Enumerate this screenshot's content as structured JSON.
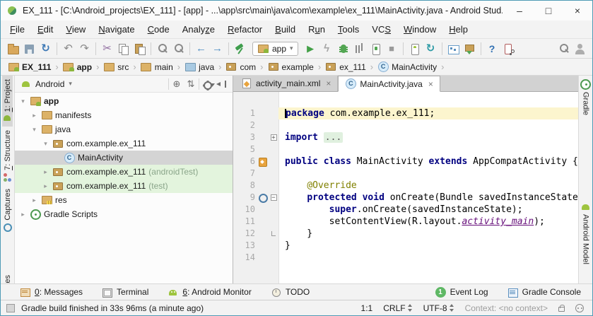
{
  "window": {
    "title": "EX_111 - [C:\\Android_projects\\EX_111] - [app] - ...\\app\\src\\main\\java\\com\\example\\ex_111\\MainActivity.java - Android Stud...",
    "controls": {
      "minimize": "–",
      "maximize": "□",
      "close": "×"
    }
  },
  "colors": {
    "android_green": "#a4c639",
    "keyword_navy": "#000080",
    "annotation_olive": "#808000",
    "resource_purple": "#660e7a",
    "caret_line_yellow": "#fcf5ce",
    "selected_row_gray": "#d4d4d4",
    "test_row_green": "#e3f4dd",
    "event_badge_green": "#5fb865",
    "run_green": "#43a047"
  },
  "menu": [
    {
      "label": "File",
      "m": 0
    },
    {
      "label": "Edit",
      "m": 0
    },
    {
      "label": "View",
      "m": 0
    },
    {
      "label": "Navigate",
      "m": 0
    },
    {
      "label": "Code",
      "m": 0
    },
    {
      "label": "Analyze",
      "m": 5
    },
    {
      "label": "Refactor",
      "m": 0
    },
    {
      "label": "Build",
      "m": 0
    },
    {
      "label": "Run",
      "m": 1
    },
    {
      "label": "Tools",
      "m": 0
    },
    {
      "label": "VCS",
      "m": 2
    },
    {
      "label": "Window",
      "m": 0
    },
    {
      "label": "Help",
      "m": 0
    }
  ],
  "toolbar": {
    "run_config": "app",
    "icons": [
      "open",
      "save",
      "sync",
      "sep",
      "undo",
      "redo",
      "sep",
      "cut",
      "copy",
      "paste",
      "sep",
      "find",
      "replace",
      "sep",
      "back",
      "forward",
      "sep",
      "hammer",
      "runconfig",
      "run",
      "apply",
      "debug",
      "profile",
      "attach",
      "stop",
      "sep",
      "avd",
      "gradle-sync",
      "sep",
      "devmon",
      "sdk",
      "sep",
      "help",
      "devlink",
      "spacer",
      "search",
      "avatar"
    ],
    "glyphs": {
      "sync": "↻",
      "gradle-sync": "↻",
      "undo": "↶",
      "redo": "↷",
      "cut": "✂",
      "back": "←",
      "forward": "→",
      "run": "▶",
      "apply": "ϟ",
      "stop": "■",
      "help": "?",
      "caret": "▾"
    }
  },
  "breadcrumb": {
    "separator": "›",
    "items": [
      {
        "label": "EX_111",
        "icon": "android-folder",
        "bold": true
      },
      {
        "label": "app",
        "icon": "android-folder",
        "bold": true
      },
      {
        "label": "src",
        "icon": "folder"
      },
      {
        "label": "main",
        "icon": "folder"
      },
      {
        "label": "java",
        "icon": "folder-blue"
      },
      {
        "label": "com",
        "icon": "package"
      },
      {
        "label": "example",
        "icon": "package"
      },
      {
        "label": "ex_111",
        "icon": "package"
      },
      {
        "label": "MainActivity",
        "icon": "class"
      }
    ]
  },
  "stripes": {
    "left": [
      {
        "pre": "",
        "u": "1",
        "post": ": Project",
        "icon": "android-project",
        "active": true,
        "name": "project"
      },
      {
        "pre": "",
        "u": "7",
        "post": ": Structure",
        "icon": "structure",
        "active": false,
        "name": "structure"
      },
      {
        "pre": "Captures",
        "u": "",
        "post": "",
        "icon": "captures",
        "active": false,
        "name": "captures"
      },
      {
        "pre": "tes",
        "u": "",
        "post": "",
        "icon": "",
        "active": false,
        "partial": true,
        "name": "favorites-partial"
      }
    ],
    "right": [
      {
        "label": "Gradle",
        "icon": "gradle",
        "name": "gradle"
      },
      {
        "label": "Android Model",
        "icon": "android",
        "name": "android-model"
      }
    ]
  },
  "project": {
    "view": "Android",
    "view_caret": "▾",
    "header_icons": [
      {
        "name": "locate",
        "glyph": "⊕"
      },
      {
        "name": "collapse-all",
        "glyph": "⇅"
      },
      {
        "name": "settings",
        "glyph": ""
      },
      {
        "name": "hide",
        "glyph": ""
      }
    ],
    "glyphs": {
      "expanded": "▾",
      "collapsed": "▸"
    },
    "tree": [
      {
        "label": "app",
        "level": 0,
        "arrow": "down",
        "icon": "android-folder",
        "bold": true
      },
      {
        "label": "manifests",
        "level": 1,
        "arrow": "right",
        "icon": "folder"
      },
      {
        "label": "java",
        "level": 1,
        "arrow": "down",
        "icon": "folder"
      },
      {
        "label": "com.example.ex_111",
        "level": 2,
        "arrow": "down",
        "icon": "package"
      },
      {
        "label": "MainActivity",
        "level": 3,
        "arrow": "none",
        "icon": "class",
        "selected": true
      },
      {
        "label": "com.example.ex_111",
        "annotation": " (androidTest)",
        "level": 2,
        "arrow": "right",
        "icon": "package",
        "green": true
      },
      {
        "label": "com.example.ex_111",
        "annotation": " (test)",
        "level": 2,
        "arrow": "right",
        "icon": "package",
        "green": true
      },
      {
        "label": "res",
        "level": 1,
        "arrow": "right",
        "icon": "res-folder"
      },
      {
        "label": "Gradle Scripts",
        "level": 0,
        "arrow": "right",
        "icon": "gradle"
      }
    ]
  },
  "editor": {
    "tabs": [
      {
        "label": "activity_main.xml",
        "icon": "xml",
        "active": false
      },
      {
        "label": "MainActivity.java",
        "icon": "class",
        "active": true
      }
    ],
    "close_glyph": "×",
    "inspection_icon": "✓",
    "fold_glyphs": {
      "plus": "+",
      "minus": "−"
    },
    "lines": [
      {
        "n": "1",
        "hl": true,
        "caret": true,
        "seg": [
          [
            "kw",
            "package"
          ],
          [
            "p",
            " com.example.ex_111;"
          ]
        ]
      },
      {
        "n": "2",
        "seg": []
      },
      {
        "n": "3",
        "fold": "plus",
        "seg": [
          [
            "kw",
            "import"
          ],
          [
            "p",
            " "
          ],
          [
            "fd",
            "..."
          ]
        ]
      },
      {
        "n": "5",
        "seg": []
      },
      {
        "n": "6",
        "g": "layout",
        "seg": [
          [
            "kw",
            "public"
          ],
          [
            "p",
            " "
          ],
          [
            "kw",
            "class"
          ],
          [
            "p",
            " MainActivity "
          ],
          [
            "kw",
            "extends"
          ],
          [
            "p",
            " AppCompatActivity {"
          ]
        ]
      },
      {
        "n": "7",
        "seg": []
      },
      {
        "n": "8",
        "seg": [
          [
            "p",
            "    "
          ],
          [
            "an",
            "@Override"
          ]
        ]
      },
      {
        "n": "9",
        "g": "override",
        "fold": "minus",
        "seg": [
          [
            "p",
            "    "
          ],
          [
            "kw",
            "protected"
          ],
          [
            "p",
            " "
          ],
          [
            "kw",
            "void"
          ],
          [
            "p",
            " onCreate(Bundle savedInstanceState) {"
          ]
        ]
      },
      {
        "n": "10",
        "seg": [
          [
            "p",
            "        "
          ],
          [
            "kw",
            "super"
          ],
          [
            "p",
            ".onCreate(savedInstanceState);"
          ]
        ]
      },
      {
        "n": "11",
        "seg": [
          [
            "p",
            "        setContentView(R.layout."
          ],
          [
            "fi",
            "activity_main"
          ],
          [
            "p",
            ");"
          ]
        ]
      },
      {
        "n": "12",
        "fold": "end",
        "seg": [
          [
            "p",
            "    }"
          ]
        ]
      },
      {
        "n": "13",
        "seg": [
          [
            "p",
            "}"
          ]
        ]
      },
      {
        "n": "14",
        "seg": []
      }
    ]
  },
  "bottombar": {
    "left": [
      {
        "icon": "messages",
        "pre": "",
        "u": "0",
        "post": ": Messages",
        "name": "messages"
      },
      {
        "icon": "terminal",
        "pre": "Terminal",
        "u": "",
        "post": "",
        "name": "terminal"
      },
      {
        "icon": "android",
        "pre": "",
        "u": "6",
        "post": ": Android Monitor",
        "name": "android-monitor"
      },
      {
        "icon": "todo",
        "pre": "TODO",
        "u": "",
        "post": "",
        "name": "todo"
      }
    ],
    "right": [
      {
        "icon": "badge",
        "badge": "1",
        "pre": "Event Log",
        "u": "",
        "post": "",
        "name": "event-log"
      },
      {
        "icon": "console",
        "pre": "Gradle Console",
        "u": "",
        "post": "",
        "name": "gradle-console"
      }
    ]
  },
  "status": {
    "message": "Gradle build finished in 33s 96ms (a minute ago)",
    "position": "1:1",
    "line_ending": "CRLF",
    "encoding": "UTF-8",
    "context": "Context: <no context>"
  }
}
